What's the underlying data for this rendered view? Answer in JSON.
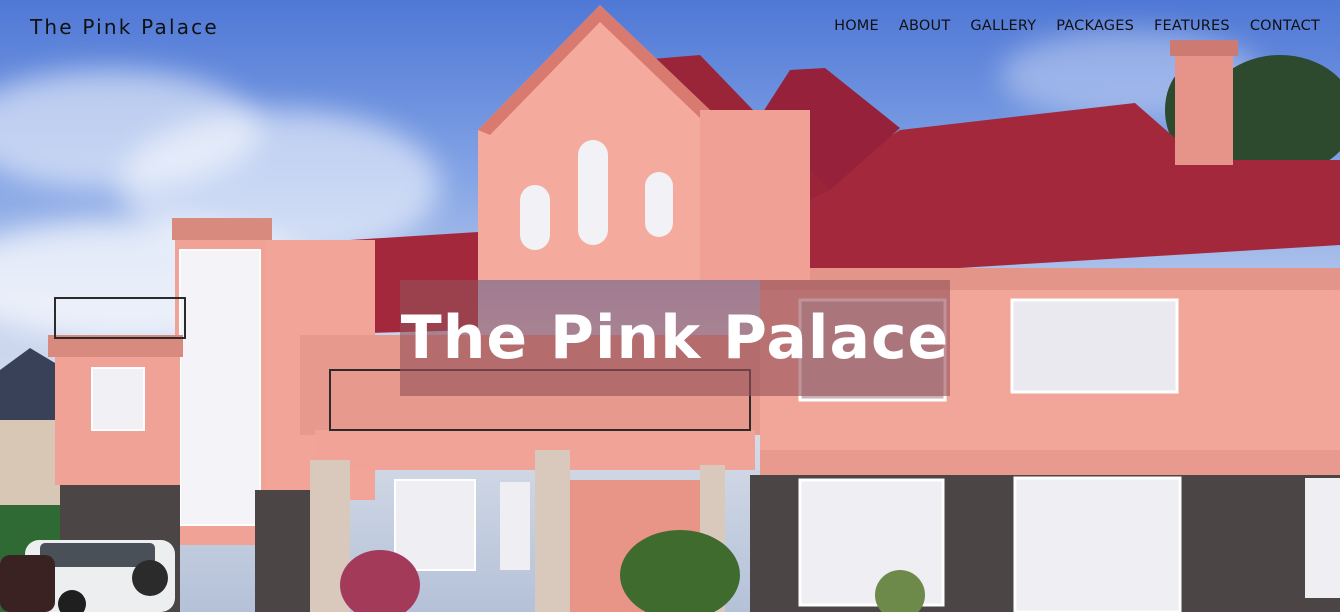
{
  "brand": "The Pink Palace",
  "nav": [
    {
      "label": "HOME"
    },
    {
      "label": "ABOUT"
    },
    {
      "label": "GALLERY"
    },
    {
      "label": "PACKAGES"
    },
    {
      "label": "FEATURES"
    },
    {
      "label": "CONTACT"
    }
  ],
  "hero": {
    "title": "The Pink Palace",
    "image": "pink-house-photo",
    "colors": {
      "sky": "#6f93d8",
      "walls": "#f3a99c",
      "roof": "#a3283b",
      "stone": "#4b4545"
    }
  }
}
